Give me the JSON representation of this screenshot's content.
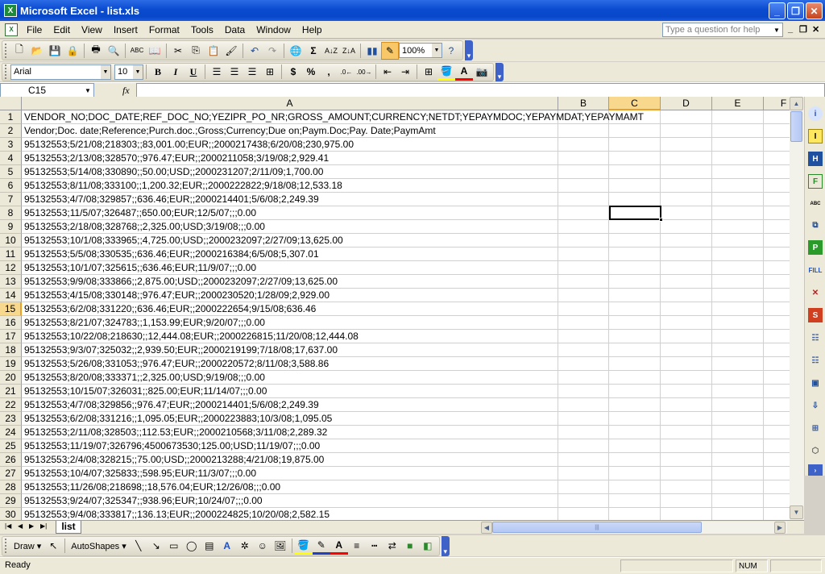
{
  "window": {
    "title": "Microsoft Excel - list.xls"
  },
  "menu": {
    "items": [
      "File",
      "Edit",
      "View",
      "Insert",
      "Format",
      "Tools",
      "Data",
      "Window",
      "Help"
    ],
    "help_placeholder": "Type a question for help"
  },
  "toolbar": {
    "zoom": "100%",
    "font_name": "Arial",
    "font_size": "10"
  },
  "formula_bar": {
    "name_box": "C15",
    "fx_label": "fx",
    "content": ""
  },
  "grid": {
    "columns": [
      "A",
      "B",
      "C",
      "D",
      "E",
      "F"
    ],
    "active_column": "C",
    "active_row": "15",
    "row_numbers": [
      "1",
      "2",
      "3",
      "4",
      "5",
      "6",
      "7",
      "8",
      "9",
      "10",
      "11",
      "12",
      "13",
      "14",
      "15",
      "16",
      "17",
      "18",
      "19",
      "20",
      "21",
      "22",
      "23",
      "24",
      "25",
      "26",
      "27",
      "28",
      "29",
      "30"
    ],
    "rows": [
      "VENDOR_NO;DOC_DATE;REF_DOC_NO;YEZIPR_PO_NR;GROSS_AMOUNT;CURRENCY;NETDT;YEPAYMDOC;YEPAYMDAT;YEPAYMAMT",
      "Vendor;Doc. date;Reference;Purch.doc.;Gross;Currency;Due on;Paym.Doc;Pay. Date;PaymAmt",
      "95132553;5/21/08;218303;;83,001.00;EUR;;2000217438;6/20/08;230,975.00",
      "95132553;2/13/08;328570;;976.47;EUR;;2000211058;3/19/08;2,929.41",
      "95132553;5/14/08;330890;;50.00;USD;;2000231207;2/11/09;1,700.00",
      "95132553;8/11/08;333100;;1,200.32;EUR;;2000222822;9/18/08;12,533.18",
      "95132553;4/7/08;329857;;636.46;EUR;;2000214401;5/6/08;2,249.39",
      "95132553;11/5/07;326487;;650.00;EUR;12/5/07;;;0.00",
      "95132553;2/18/08;328768;;2,325.00;USD;3/19/08;;;0.00",
      "95132553;10/1/08;333965;;4,725.00;USD;;2000232097;2/27/09;13,625.00",
      "95132553;5/5/08;330535;;636.46;EUR;;2000216384;6/5/08;5,307.01",
      "95132553;10/1/07;325615;;636.46;EUR;11/9/07;;;0.00",
      "95132553;9/9/08;333866;;2,875.00;USD;;2000232097;2/27/09;13,625.00",
      "95132553;4/15/08;330148;;976.47;EUR;;2000230520;1/28/09;2,929.00",
      "95132553;6/2/08;331220;;636.46;EUR;;2000222654;9/15/08;636.46",
      "95132553;8/21/07;324783;;1,153.99;EUR;9/20/07;;;0.00",
      "95132553;10/22/08;218630;;12,444.08;EUR;;2000226815;11/20/08;12,444.08",
      "95132553;9/3/07;325032;;2,939.50;EUR;;2000219199;7/18/08;17,637.00",
      "95132553;5/26/08;331053;;976.47;EUR;;2000220572;8/11/08;3,588.86",
      "95132553;8/20/08;333371;;2,325.00;USD;9/19/08;;;0.00",
      "95132553;10/15/07;326031;;825.00;EUR;11/14/07;;;0.00",
      "95132553;4/7/08;329856;;976.47;EUR;;2000214401;5/6/08;2,249.39",
      "95132553;6/2/08;331216;;1,095.05;EUR;;2000223883;10/3/08;1,095.05",
      "95132553;2/11/08;328503;;112.53;EUR;;2000210568;3/11/08;2,289.32",
      "95132553;11/19/07;326796;4500673530;125.00;USD;11/19/07;;;0.00",
      "95132553;2/4/08;328215;;75.00;USD;;2000213288;4/21/08;19,875.00",
      "95132553;10/4/07;325833;;598.95;EUR;11/3/07;;;0.00",
      "95132553;11/26/08;218698;;18,576.04;EUR;12/26/08;;;0.00",
      "95132553;9/24/07;325347;;938.96;EUR;10/24/07;;;0.00",
      "95132553;9/4/08;333817;;136.13;EUR;;2000224825;10/20/08;2,582.15"
    ]
  },
  "sheets": {
    "active": "list"
  },
  "drawing": {
    "draw_label": "Draw",
    "autoshapes_label": "AutoShapes"
  },
  "status": {
    "text": "Ready",
    "num": "NUM"
  }
}
